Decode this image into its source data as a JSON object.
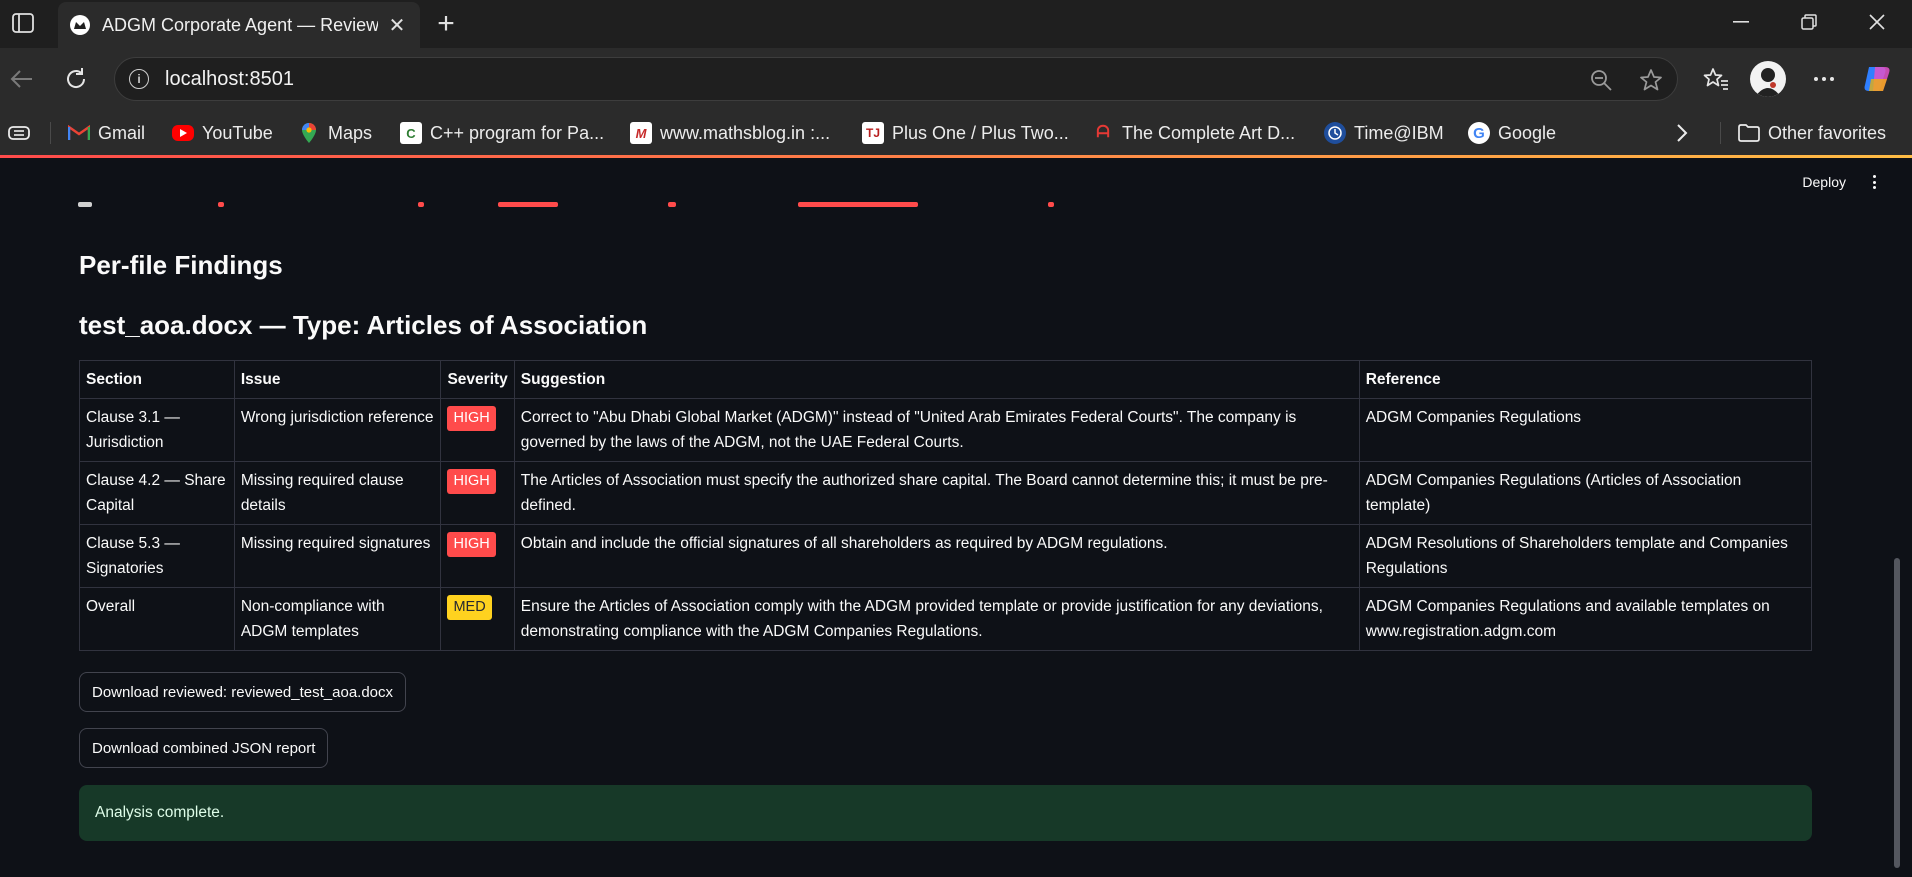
{
  "browser": {
    "tab_title": "ADGM Corporate Agent — Review",
    "url": "localhost:8501",
    "bookmarks": [
      {
        "label": "Gmail",
        "icon": "gmail-icon"
      },
      {
        "label": "YouTube",
        "icon": "youtube-icon"
      },
      {
        "label": "Maps",
        "icon": "maps-icon"
      },
      {
        "label": "C++ program for Pa...",
        "icon": "cpp-icon"
      },
      {
        "label": "www.mathsblog.in :...",
        "icon": "mathsblog-icon"
      },
      {
        "label": "Plus One / Plus Two...",
        "icon": "plusone-icon"
      },
      {
        "label": "The Complete Art D...",
        "icon": "art-icon"
      },
      {
        "label": "Time@IBM",
        "icon": "clock-icon"
      },
      {
        "label": "Google",
        "icon": "google-icon"
      }
    ],
    "other_favorites": "Other favorites"
  },
  "app": {
    "deploy_label": "Deploy",
    "heading": "Per-file Findings",
    "file_heading": "test_aoa.docx — Type: Articles of Association",
    "table": {
      "headers": [
        "Section",
        "Issue",
        "Severity",
        "Suggestion",
        "Reference"
      ],
      "rows": [
        {
          "section": "Clause 3.1 — Jurisdiction",
          "issue": "Wrong jurisdiction reference",
          "severity": "HIGH",
          "suggestion": "Correct to \"Abu Dhabi Global Market (ADGM)\" instead of \"United Arab Emirates Federal Courts\". The company is governed by the laws of the ADGM, not the UAE Federal Courts.",
          "reference": "ADGM Companies Regulations"
        },
        {
          "section": "Clause 4.2 — Share Capital",
          "issue": "Missing required clause details",
          "severity": "HIGH",
          "suggestion": "The Articles of Association must specify the authorized share capital. The Board cannot determine this; it must be pre-defined.",
          "reference": "ADGM Companies Regulations (Articles of Association template)"
        },
        {
          "section": "Clause 5.3 — Signatories",
          "issue": "Missing required signatures",
          "severity": "HIGH",
          "suggestion": "Obtain and include the official signatures of all shareholders as required by ADGM regulations.",
          "reference": "ADGM Resolutions of Shareholders template and Companies Regulations"
        },
        {
          "section": "Overall",
          "issue": "Non-compliance with ADGM templates",
          "severity": "MED",
          "suggestion": "Ensure the Articles of Association comply with the ADGM provided template or provide justification for any deviations, demonstrating compliance with the ADGM Companies Regulations.",
          "reference": "ADGM Companies Regulations and available templates on www.registration.adgm.com"
        }
      ]
    },
    "download_reviewed": "Download reviewed: reviewed_test_aoa.docx",
    "download_json": "Download combined JSON report",
    "status": "Analysis complete."
  },
  "colors": {
    "background": "#0e1117",
    "severity_high": "#ff4b4b",
    "severity_med": "#ffd21f",
    "success_bg": "#173928"
  }
}
